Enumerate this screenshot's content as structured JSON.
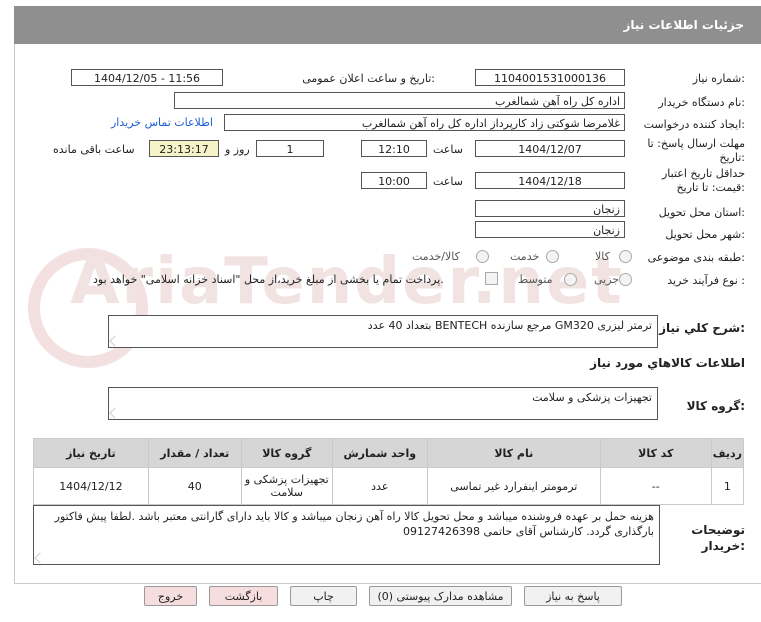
{
  "header": {
    "title": "جزئیات اطلاعات نیاز"
  },
  "labels": {
    "need_no": "شماره نیاز:",
    "announce_dt": "تاریخ و ساعت اعلان عمومی:",
    "buyer_org": "نام دستگاه خریدار:",
    "requester": "ایجاد کننده درخواست:",
    "contact_link": "اطلاعات تماس خریدار",
    "reply_deadline": "مهلت ارسال پاسخ: تا تاریخ:",
    "time": "ساعت",
    "day_and": "روز و",
    "remaining": "ساعت باقی مانده",
    "price_validity": "حداقل تاریخ اعتبار قیمت: تا تاریخ:",
    "time2": "ساعت",
    "province": "استان محل تحویل:",
    "city": "شهر محل تحویل:",
    "category": "طبقه بندی موضوعی:",
    "process_type": "نوع فرآیند خرید :",
    "general_desc": "شرح کلي نياز:",
    "items_info": "اطلاعات کالاهاي مورد نياز",
    "goods_group": "گروه کالا:",
    "buyer_notes": "توضیحات خریدار:"
  },
  "values": {
    "need_no": "1104001531000136",
    "announce_dt": "1404/12/05 - 11:56",
    "buyer_org": "اداره کل راه آهن شمالغرب",
    "requester": "غلامرضا شوکتی زاد کارپرداز اداره کل راه آهن شمالغرب",
    "reply_date": "1404/12/07",
    "reply_time": "12:10",
    "days": "1",
    "remaining_time": "23:13:17",
    "validity_date": "1404/12/18",
    "validity_time": "10:00",
    "province": "زنجان",
    "city": "زنجان"
  },
  "category_options": [
    {
      "label": "کالا",
      "selected": true
    },
    {
      "label": "خدمت",
      "selected": false
    },
    {
      "label": "کالا/خدمت",
      "selected": false
    }
  ],
  "process_options": [
    {
      "label": "جزیی",
      "selected": true
    },
    {
      "label": "متوسط",
      "selected": false
    }
  ],
  "payment_note": "پرداخت تمام یا بخشی از مبلغ خرید،از محل \"اسناد خزانه اسلامی\" خواهد بود.",
  "general_desc": "ترمتر لیزری GM320 مرجع سازنده BENTECH بتعداد 40 عدد",
  "goods_group": "تجهیزات پزشکی و سلامت",
  "table": {
    "headers": [
      "ردیف",
      "کد کالا",
      "نام کالا",
      "واحد شمارش",
      "گروه کالا",
      "تعداد / مقدار",
      "تاریخ نیاز"
    ],
    "rows": [
      [
        "1",
        "--",
        "ترمومتر اینفرارد غیر تماسی",
        "عدد",
        "تجهیزات پزشکی و سلامت",
        "40",
        "1404/12/12"
      ]
    ]
  },
  "buyer_notes": "هزینه حمل بر عهده فروشنده میباشد و محل تحویل کالا راه آهن زنجان میباشد و کالا باید دارای گارانتی معتبر باشد .لطفا پیش فاکتور بارگذاری گردد. کارشناس آقای حاتمی 09127426398",
  "buttons": {
    "reply": "پاسخ به نیاز",
    "view_docs": "مشاهده مدارک پیوستی (0)",
    "print": "چاپ",
    "back": "بازگشت",
    "exit": "خروج"
  },
  "watermark": "AriaTender.net",
  "colors": {
    "header_bg": "#8f8f8f",
    "link": "#1a5bd8",
    "remaining_bg": "#f6f3c8",
    "exit_bg": "#f7dede"
  }
}
